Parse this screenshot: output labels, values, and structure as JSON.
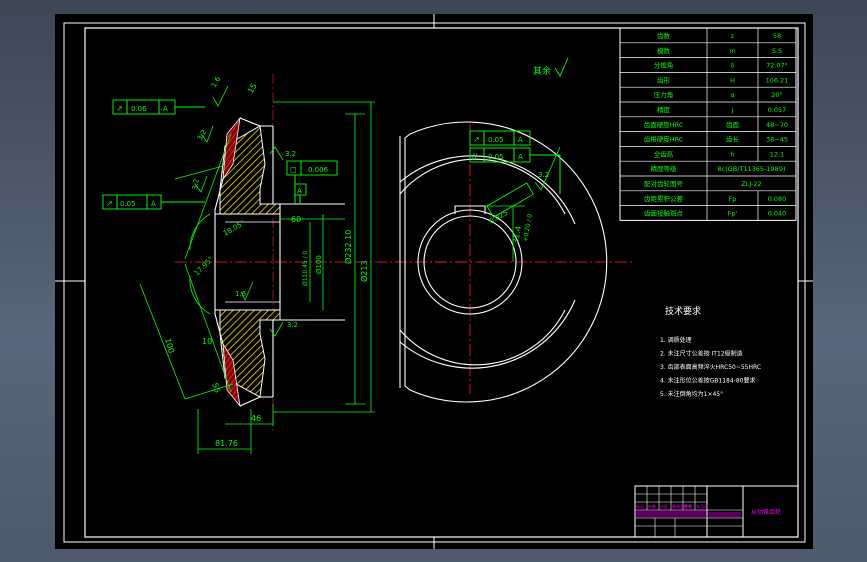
{
  "drawing": {
    "roughness_note": "其余",
    "params_table": [
      {
        "name": "齿数",
        "symbol": "z",
        "value": "58"
      },
      {
        "name": "模数",
        "symbol": "m",
        "value": "5.5"
      },
      {
        "name": "分锥角",
        "symbol": "δ",
        "value": "72.07°"
      },
      {
        "name": "齿形",
        "symbol": "H",
        "value": "106.21"
      },
      {
        "name": "压力角",
        "symbol": "α",
        "value": "20°"
      },
      {
        "name": "精度",
        "symbol": "j",
        "value": "0.057"
      },
      {
        "name": "齿面硬度HRC",
        "symbol": "齿面",
        "value": "48~70"
      },
      {
        "name": "齿根硬度HRC",
        "symbol": "齿长",
        "value": "38~45"
      },
      {
        "name": "全齿高",
        "symbol": "h",
        "value": "12.1"
      },
      {
        "name": "精度等级",
        "symbol": "",
        "value": "8c(GB/T11365-1989)"
      },
      {
        "name": "配对齿轮图号",
        "symbol": "",
        "value": "ZLJ-22"
      },
      {
        "name": "齿距累积公差",
        "symbol": "Fp",
        "value": "0.080"
      },
      {
        "name": "齿面接触斑点",
        "symbol": "Fp'",
        "value": "0.040"
      }
    ],
    "tech_requirements": {
      "title": "技术要求",
      "items": [
        "1. 调质处理",
        "2. 未注尺寸公差按 IT12级制造",
        "3. 齿部表面高频淬火HRC50~55HRC",
        "4. 未注形位公差按GB1184-80要求",
        "5. 未注倒角均为1×45°"
      ]
    },
    "dimensions": {
      "d1": "Ø232.10",
      "d2": "Ø213",
      "d3": "Ø100",
      "d4": "Ø110.45 / 0",
      "bore": "60",
      "len1": "81.76",
      "len2": "46",
      "len3": "15",
      "len4": "10",
      "len5": "55",
      "len6": "100",
      "angle1": "18.05°",
      "angle2": "17.95°",
      "rough1": "1.6",
      "rough2": "3.2",
      "rough3": "3.2",
      "rough4": "1.6",
      "rough5": "3.2",
      "rough6": "3.2",
      "keyway": "31.4",
      "keyway_tol": "+0.20 / 0",
      "tol_frame1": {
        "symbol": "↗",
        "value": "0.06",
        "datum": "A"
      },
      "tol_frame2": {
        "symbol": "↗",
        "value": "0.05",
        "datum": "A"
      },
      "tol_frame3": {
        "symbol": "◻",
        "value": "0.006"
      },
      "tol_frame4": {
        "symbol": "↗",
        "value": "0.05",
        "datum": "A"
      },
      "tol_frame5": {
        "symbol": "//",
        "value": "0.05",
        "datum": "A"
      },
      "keyway_frame": {
        "symbol": "≡",
        "value": "0.025"
      },
      "datum_label": "A"
    },
    "title_block": {
      "name": "从动锥齿轮",
      "cells": [
        "标记",
        "处数",
        "分区",
        "更改文件号",
        "签名",
        "年月日"
      ]
    }
  },
  "colors": {
    "border": "#ffffff",
    "outline": "#ffffff",
    "dimension": "#00ff00",
    "center": "#ff2020",
    "section_fill": "#e8e800",
    "annotation": "#ff00ff",
    "teeth_fill": "#d80000"
  }
}
